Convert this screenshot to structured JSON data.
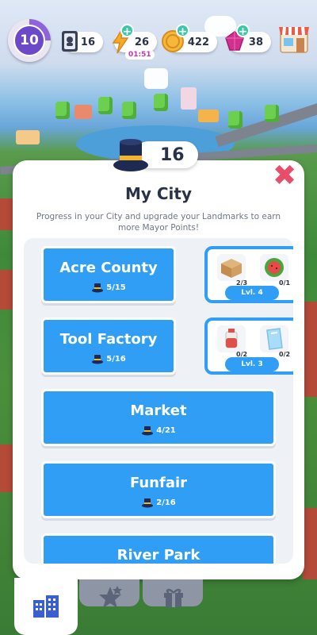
{
  "hud": {
    "level": "10",
    "cards": "16",
    "energy": "26",
    "energy_timer": "01:51",
    "coins": "422",
    "gems": "38"
  },
  "panel": {
    "mayor_points": "16",
    "title": "My City",
    "subtitle": "Progress in your City and upgrade your Landmarks to earn more Mayor Points!"
  },
  "landmarks": [
    {
      "name": "Acre County",
      "progress": "5/15",
      "resources": [
        "2/3",
        "0/1"
      ],
      "level": "Lvl. 4",
      "icons": [
        "cardboard-box-icon",
        "watermelon-icon"
      ]
    },
    {
      "name": "Tool Factory",
      "progress": "5/16",
      "resources": [
        "0/2",
        "0/2"
      ],
      "level": "Lvl. 3",
      "icons": [
        "paint-bucket-icon",
        "glass-pane-icon"
      ]
    },
    {
      "name": "Market",
      "progress": "4/21"
    },
    {
      "name": "Funfair",
      "progress": "2/16"
    },
    {
      "name": "River Park"
    }
  ],
  "tabs": [
    "city-icon",
    "star-upgrade-icon",
    "gift-icon"
  ],
  "colors": {
    "card_blue": "#2f9ef4",
    "panel_white": "#ffffff",
    "close_pink": "#ea4d6a",
    "level_purple": "#6c49c9"
  }
}
